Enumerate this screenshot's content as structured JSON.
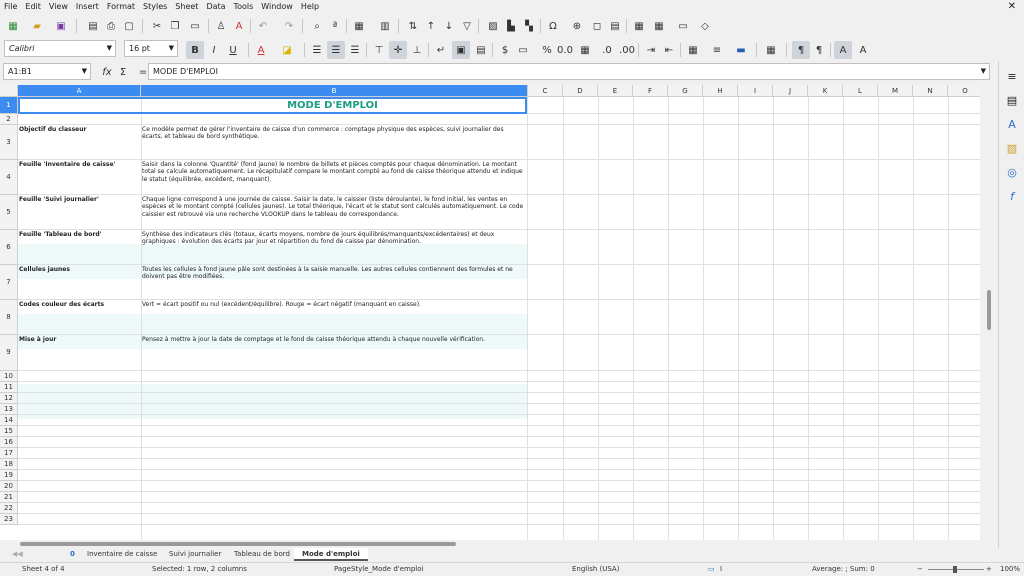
{
  "menu": [
    "File",
    "Edit",
    "View",
    "Insert",
    "Format",
    "Styles",
    "Sheet",
    "Data",
    "Tools",
    "Window",
    "Help"
  ],
  "close_glyph": "✕",
  "font": {
    "name": "Calibri",
    "size": "16 pt"
  },
  "name_box": "A1:B1",
  "formula": {
    "fx": "fx",
    "sum": "Σ",
    "eq": "=",
    "content": "MODE D'EMPLOI"
  },
  "columns": [
    "A",
    "B",
    "C",
    "D",
    "E",
    "F",
    "G",
    "H",
    "I",
    "J",
    "K",
    "L",
    "M",
    "N",
    "O"
  ],
  "rows": [
    "1",
    "2",
    "3",
    "4",
    "5",
    "6",
    "7",
    "8",
    "9",
    "10",
    "11",
    "12",
    "13",
    "14",
    "15",
    "16",
    "17",
    "18",
    "19",
    "20",
    "21",
    "22",
    "23"
  ],
  "title": "MODE D'EMPLOI",
  "entries": [
    {
      "key": "Objectif du classeur",
      "text": "Ce modèle permet de gérer l'inventaire de caisse d'un commerce : comptage physique des espèces, suivi journalier des écarts, et tableau de bord synthétique."
    },
    {
      "key": "Feuille 'Inventaire de caisse'",
      "text": "Saisir dans la colonne 'Quantité' (fond jaune) le nombre de billets et pièces comptés pour chaque dénomination. Le montant total se calcule automatiquement. Le récapitulatif compare le montant compté au fond de caisse théorique attendu et indique le statut (équilibrée, excédent, manquant)."
    },
    {
      "key": "Feuille 'Suivi journalier'",
      "text": "Chaque ligne correspond à une journée de caisse. Saisir la date, le caissier (liste déroulante), le fond initial, les ventes en espèces et le montant compté (cellules jaunes). Le total théorique, l'écart et le statut sont calculés automatiquement. Le code caissier est retrouvé via une recherche VLOOKUP dans le tableau de correspondance."
    },
    {
      "key": "Feuille 'Tableau de bord'",
      "text": "Synthèse des indicateurs clés (totaux, écarts moyens, nombre de jours équilibrés/manquants/excédentaires) et deux graphiques : évolution des écarts par jour et répartition du fond de caisse par dénomination."
    },
    {
      "key": "Cellules jaunes",
      "text": "Toutes les cellules à fond jaune pâle sont destinées à la saisie manuelle. Les autres cellules contiennent des formules et ne doivent pas être modifiées."
    },
    {
      "key": "Codes couleur des écarts",
      "text": "Vert = écart positif ou nul (excédent/équilibre). Rouge = écart négatif (manquant en caisse)."
    },
    {
      "key": "Mise à jour",
      "text": "Pensez à mettre à jour la date de comptage et le fond de caisse théorique attendu à chaque nouvelle vérification."
    }
  ],
  "tabs": [
    "Inventaire de caisse",
    "Suivi journalier",
    "Tableau de bord",
    "Mode d'emploi"
  ],
  "tab_nav": "0",
  "status": {
    "sheet": "Sheet 4 of 4",
    "selection": "Selected: 1 row, 2 columns",
    "pagestyle": "PageStyle_Mode d'emploi",
    "language": "English (USA)",
    "summary": "Average: ; Sum: 0",
    "zoom": "100%"
  },
  "colors": {
    "accent": "#3b8bf0",
    "title": "#1a9f85",
    "band": "#eefafa"
  }
}
